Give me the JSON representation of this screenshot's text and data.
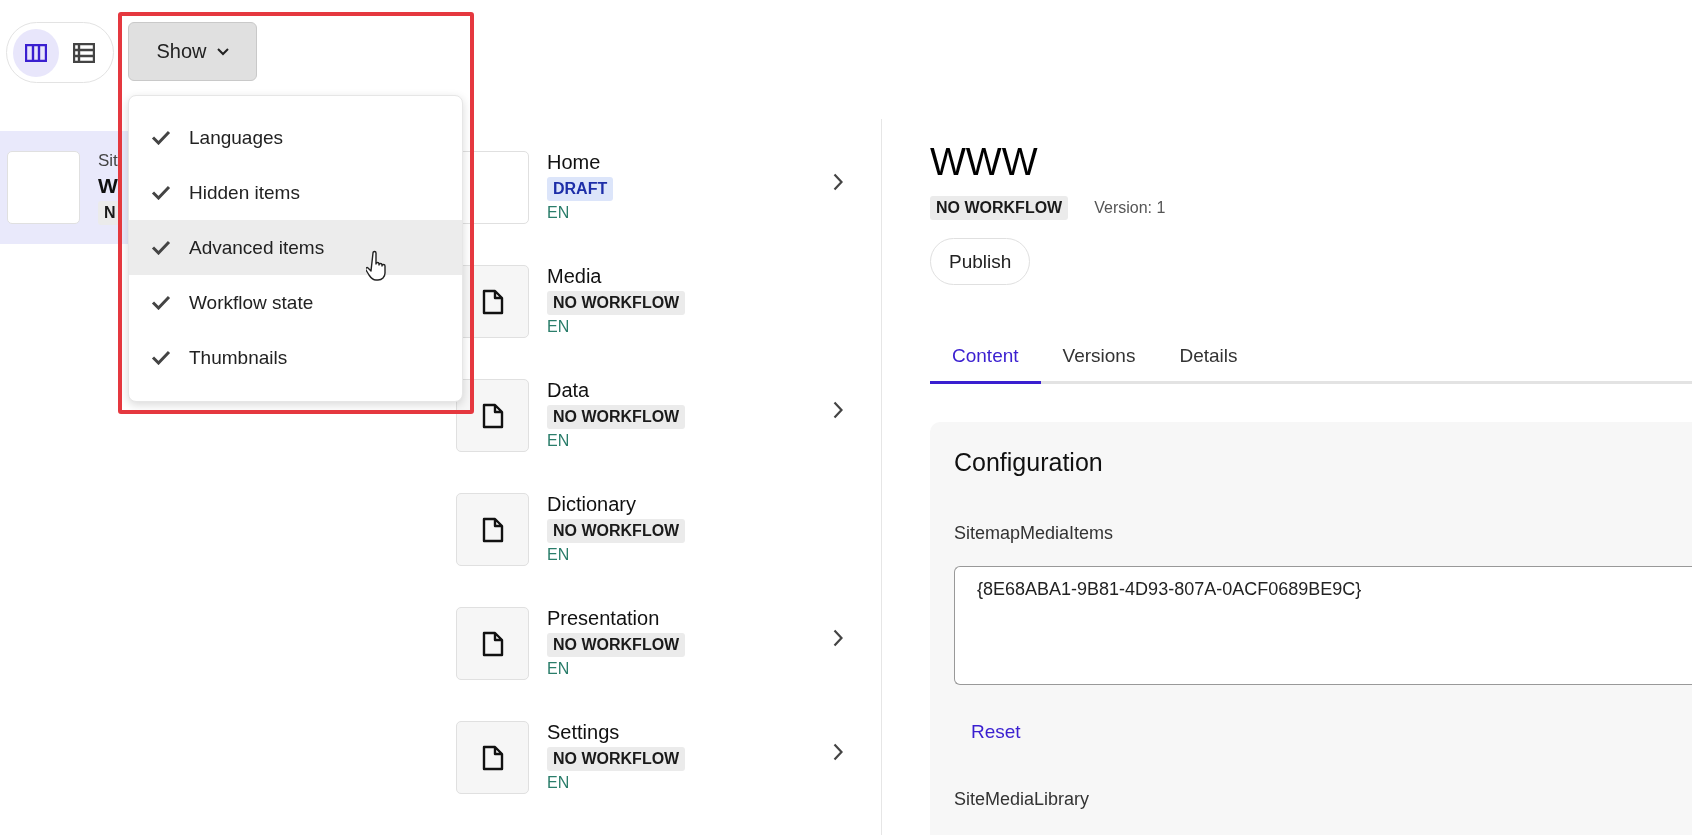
{
  "view_toggle": [
    {
      "kind": "columns",
      "selected": true
    },
    {
      "kind": "list",
      "selected": false
    }
  ],
  "show_button": {
    "label": "Show",
    "expanded": true
  },
  "show_menu": [
    {
      "label": "Languages",
      "checked": true,
      "highlighted": false
    },
    {
      "label": "Hidden items",
      "checked": true,
      "highlighted": false
    },
    {
      "label": "Advanced items",
      "checked": true,
      "highlighted": true
    },
    {
      "label": "Workflow state",
      "checked": true,
      "highlighted": false
    },
    {
      "label": "Thumbnails",
      "checked": true,
      "highlighted": false
    }
  ],
  "left_column": [
    {
      "name": "Sit",
      "title": "W",
      "badge": "N",
      "selected": true
    }
  ],
  "middle_column": [
    {
      "name": "Home",
      "status": {
        "text": "DRAFT",
        "kind": "draft"
      },
      "language": "EN",
      "thumbnail": {
        "kind": "blank"
      },
      "has_children": true
    },
    {
      "name": "Media",
      "status": {
        "text": "NO WORKFLOW",
        "kind": "none"
      },
      "language": "EN",
      "thumbnail": {
        "kind": "file"
      },
      "has_children": false
    },
    {
      "name": "Data",
      "status": {
        "text": "NO WORKFLOW",
        "kind": "none"
      },
      "language": "EN",
      "thumbnail": {
        "kind": "file"
      },
      "has_children": true
    },
    {
      "name": "Dictionary",
      "status": {
        "text": "NO WORKFLOW",
        "kind": "none"
      },
      "language": "EN",
      "thumbnail": {
        "kind": "file"
      },
      "has_children": false
    },
    {
      "name": "Presentation",
      "status": {
        "text": "NO WORKFLOW",
        "kind": "none"
      },
      "language": "EN",
      "thumbnail": {
        "kind": "file"
      },
      "has_children": true
    },
    {
      "name": "Settings",
      "status": {
        "text": "NO WORKFLOW",
        "kind": "none"
      },
      "language": "EN",
      "thumbnail": {
        "kind": "file"
      },
      "has_children": true
    }
  ],
  "detail": {
    "title": "WWW",
    "status": {
      "text": "NO WORKFLOW",
      "kind": "none"
    },
    "version": "Version: 1",
    "publish_button": "Publish",
    "tabs": [
      {
        "label": "Content",
        "selected": true
      },
      {
        "label": "Versions",
        "selected": false
      },
      {
        "label": "Details",
        "selected": false
      }
    ],
    "section": {
      "title": "Configuration",
      "fields": [
        {
          "label": "SitemapMediaItems",
          "value": "{8E68ABA1-9B81-4D93-807A-0ACF0689BE9C}",
          "reset": "Reset"
        },
        {
          "label": "SiteMediaLibrary"
        }
      ]
    }
  }
}
